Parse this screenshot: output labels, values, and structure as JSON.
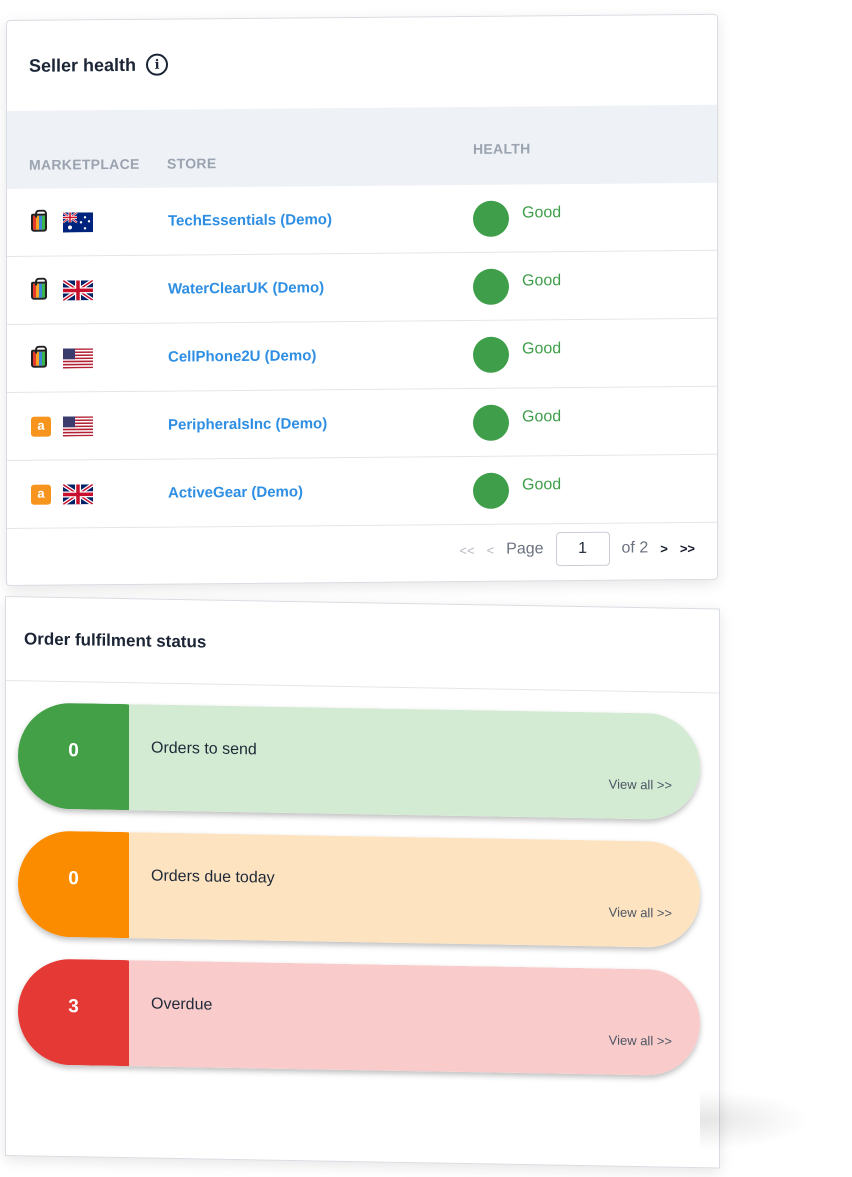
{
  "seller_health": {
    "title": "Seller health",
    "info_icon": "info-icon",
    "columns": {
      "marketplace": "MARKETPLACE",
      "store": "STORE",
      "health": "HEALTH"
    },
    "rows": [
      {
        "marketplace_icon": "shopping-bag-icon",
        "flag": "australia-flag",
        "store": "TechEssentials (Demo)",
        "health": "Good"
      },
      {
        "marketplace_icon": "shopping-bag-icon",
        "flag": "uk-flag",
        "store": "WaterClearUK (Demo)",
        "health": "Good"
      },
      {
        "marketplace_icon": "shopping-bag-icon",
        "flag": "us-flag",
        "store": "CellPhone2U (Demo)",
        "health": "Good"
      },
      {
        "marketplace_icon": "amazon-icon",
        "flag": "us-flag",
        "store": "PeripheralsInc (Demo)",
        "health": "Good"
      },
      {
        "marketplace_icon": "amazon-icon",
        "flag": "uk-flag",
        "store": "ActiveGear (Demo)",
        "health": "Good"
      }
    ],
    "pager": {
      "first": "<<",
      "prev": "<",
      "page_label": "Page",
      "current_page": "1",
      "of_label": "of 2",
      "next": ">",
      "last": ">>"
    },
    "colors": {
      "good": "#3f9e4a",
      "link": "#2d8ee3"
    }
  },
  "order_fulfilment": {
    "title": "Order fulfilment status",
    "items": [
      {
        "count": "0",
        "label": "Orders to send",
        "link": "View all >>",
        "color": "#43a047",
        "bg": "#d3ebd3"
      },
      {
        "count": "0",
        "label": "Orders due today",
        "link": "View all >>",
        "color": "#fb8c00",
        "bg": "#fde3c0"
      },
      {
        "count": "3",
        "label": "Overdue",
        "link": "View all >>",
        "color": "#e53935",
        "bg": "#f9cccb"
      }
    ]
  }
}
